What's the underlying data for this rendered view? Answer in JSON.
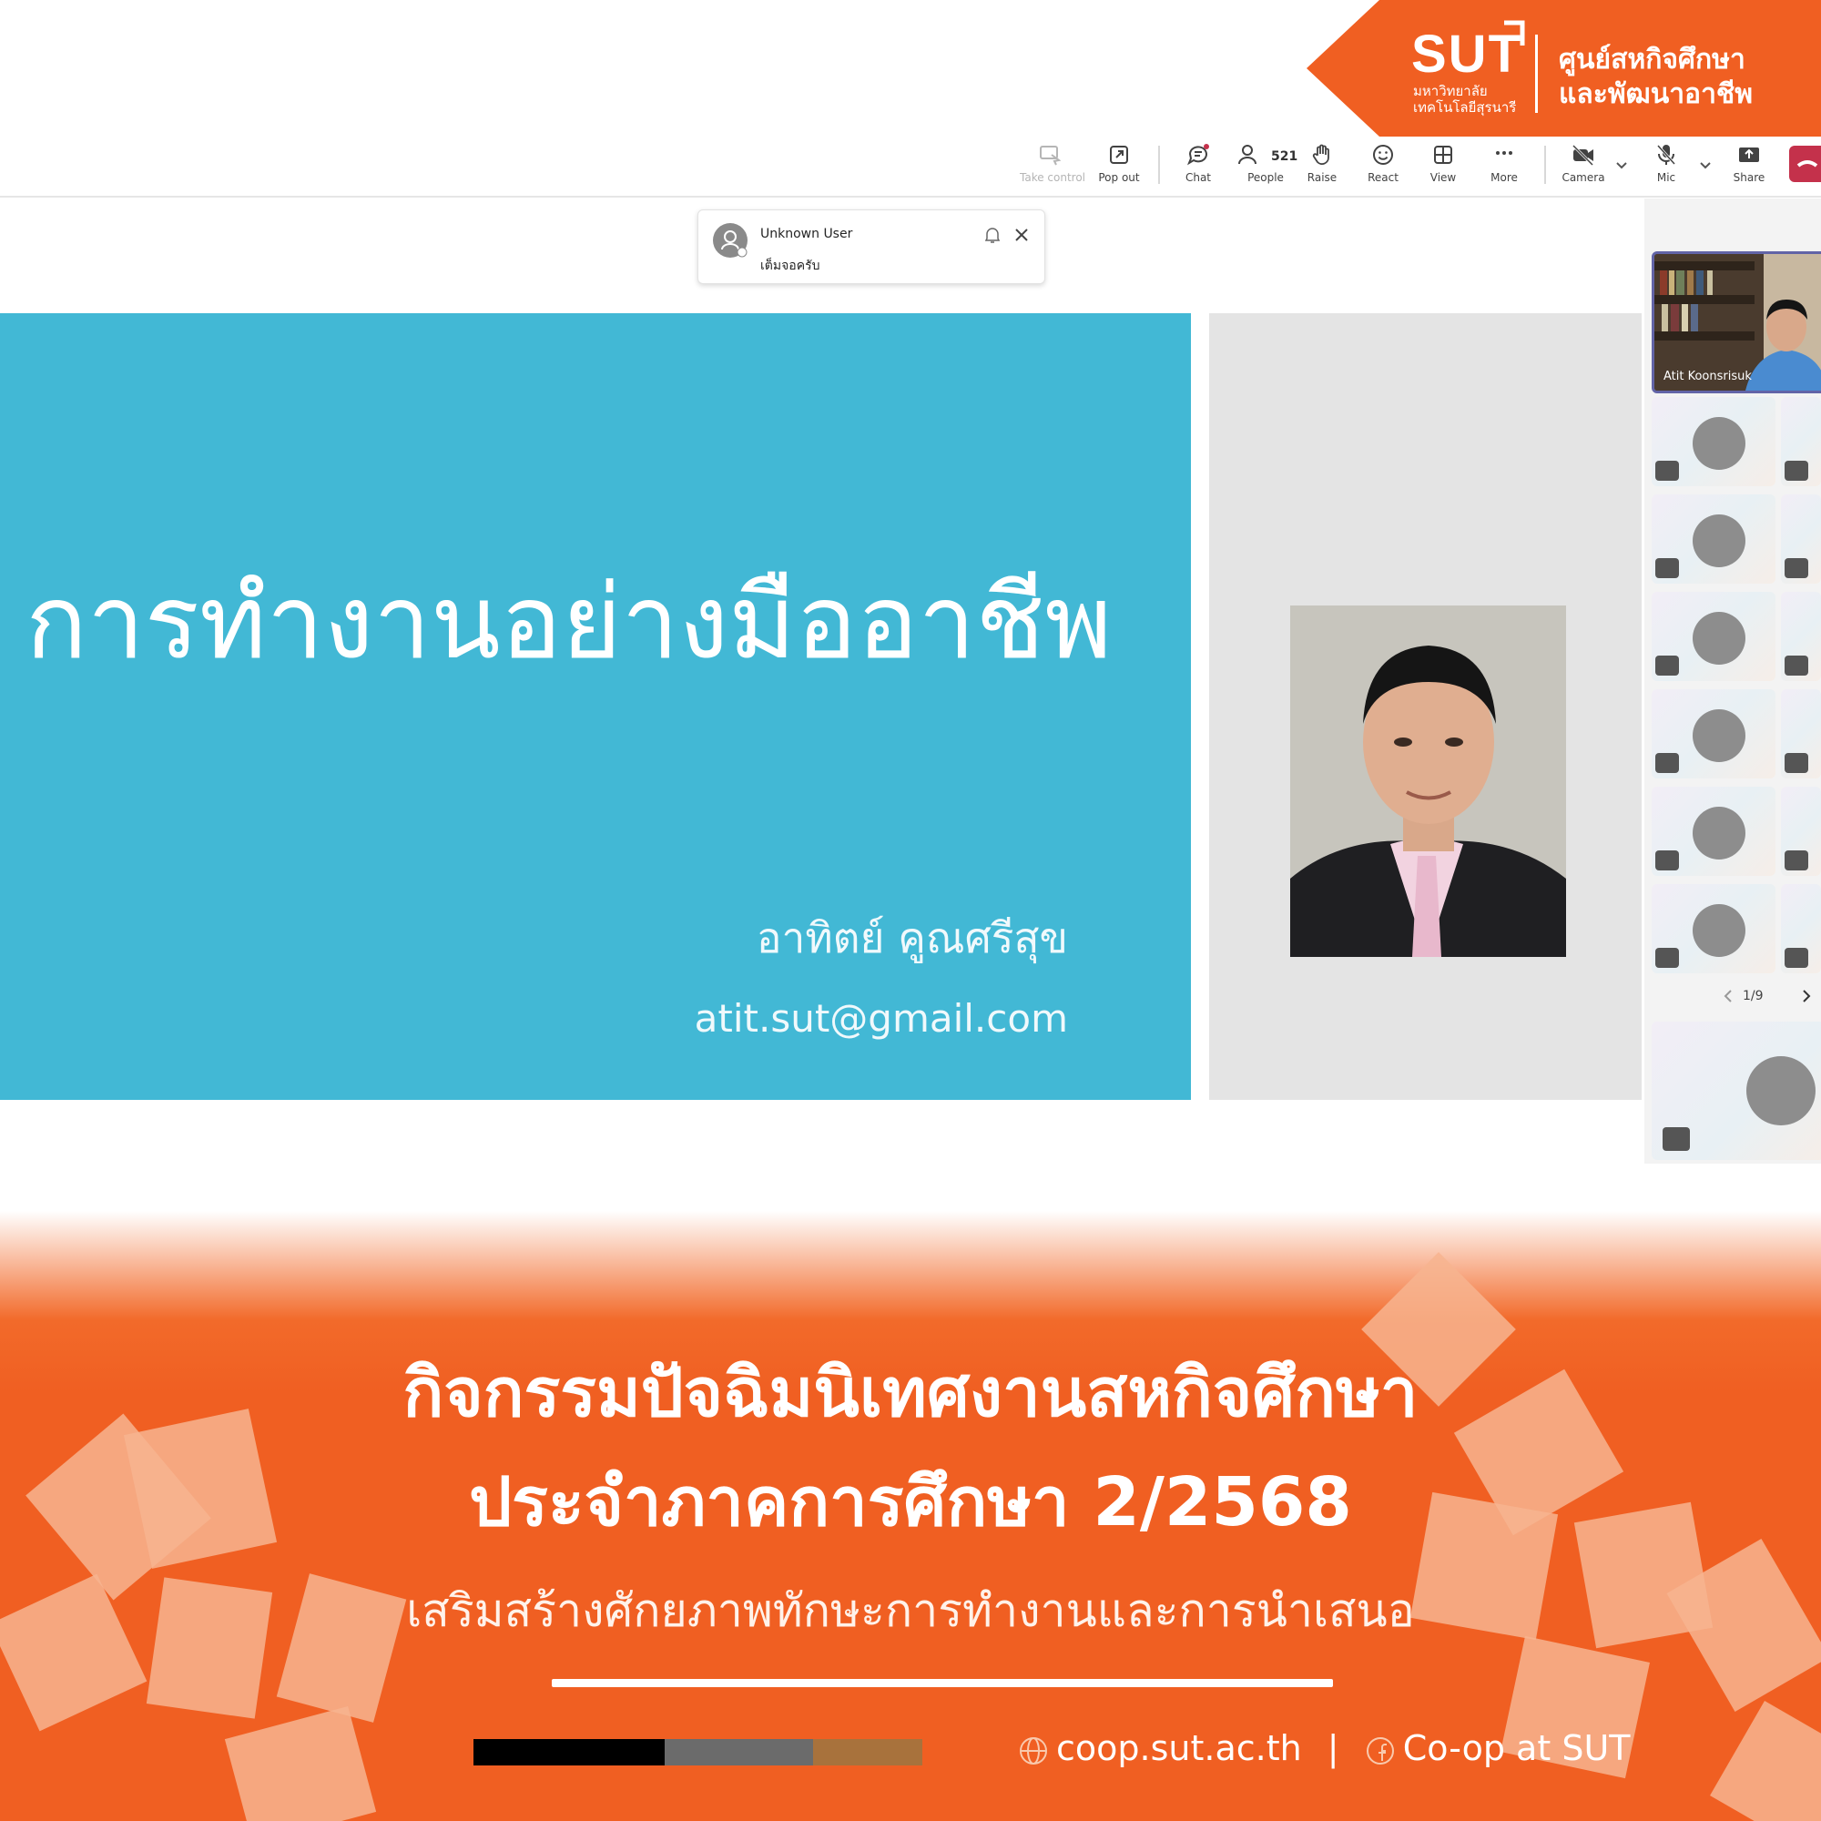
{
  "header_badge": {
    "logo_text": "SUT",
    "logo_sub_line1": "มหาวิทยาลัย",
    "logo_sub_line2": "เทคโนโลยีสุรนารี",
    "title_line1": "ศูนย์สหกิจศึกษา",
    "title_line2": "และพัฒนาอาชีพ",
    "color": "#f05f22"
  },
  "toolbar": {
    "take_control": "Take control",
    "pop_out": "Pop out",
    "chat": "Chat",
    "people": "People",
    "people_count": "521",
    "raise": "Raise",
    "react": "React",
    "view": "View",
    "more": "More",
    "camera": "Camera",
    "mic": "Mic",
    "share": "Share"
  },
  "notification": {
    "sender": "Unknown User",
    "message": "เต็มจอครับ"
  },
  "slide": {
    "title": "การทำงานอย่างมืออาชีพ",
    "presenter_name": "อาทิตย์ คูณศรีสุข",
    "email": "atit.sut@gmail.com",
    "background": "#42b8d5"
  },
  "participants": {
    "active_speaker": "Atit Koonsrisuk",
    "pager": "1/9"
  },
  "banner": {
    "title_line1": "กิจกรรมปัจฉิมนิเทศงานสหกิจศึกษา",
    "title_line2": "ประจำภาคการศึกษา 2/2568",
    "subtitle": "เสริมสร้างศักยภาพทักษะการทำงานและการนำเสนอ",
    "website": "coop.sut.ac.th",
    "separator": "|",
    "facebook": "Co-op at SUT",
    "strip_colors": [
      "#000000",
      "#6b6b6b",
      "#a8723c"
    ]
  }
}
